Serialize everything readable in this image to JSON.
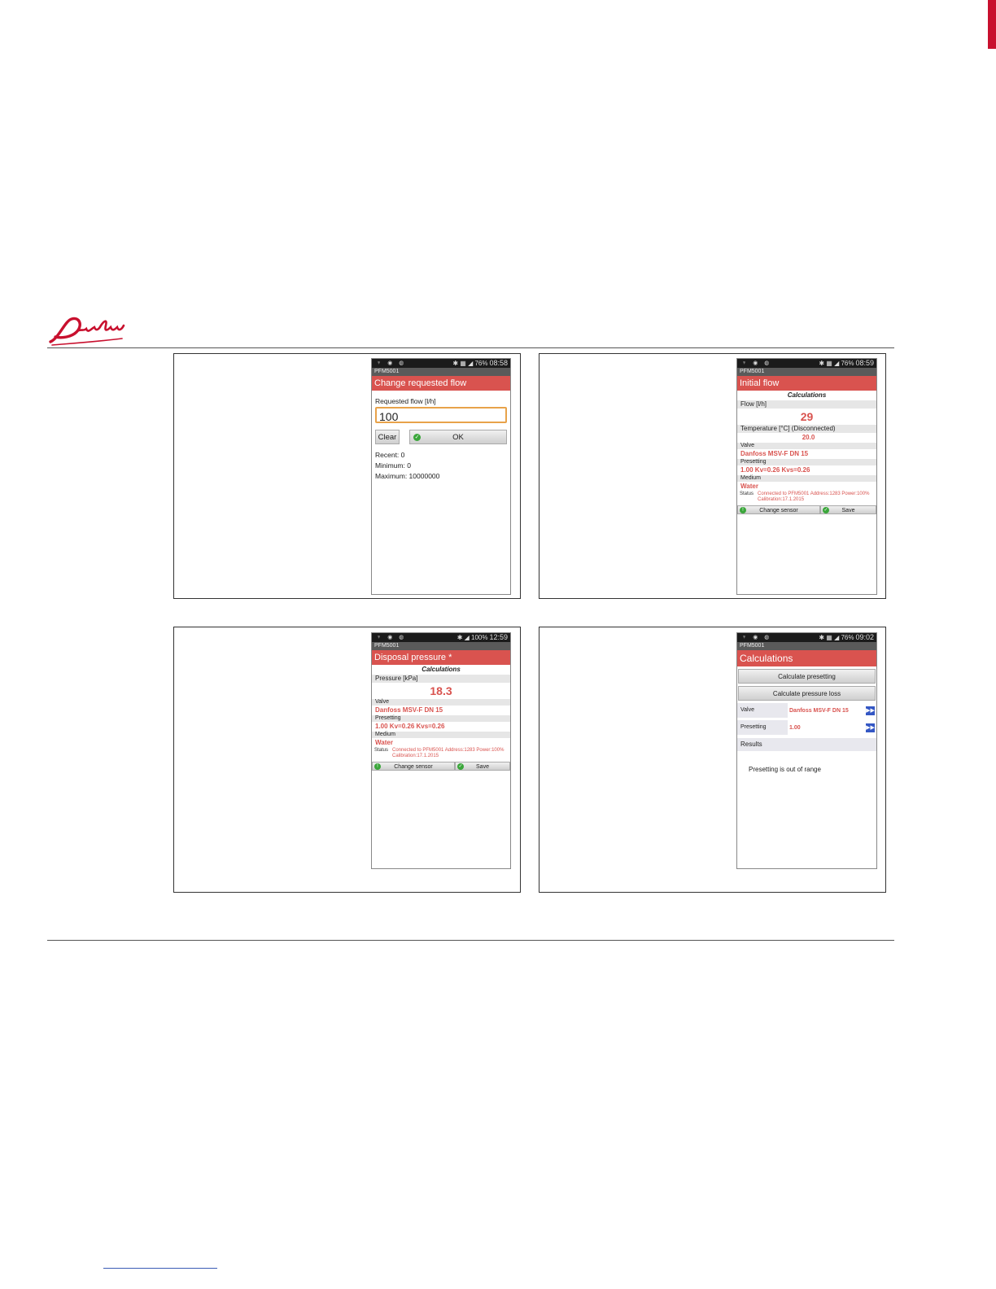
{
  "brand": {
    "name": "Danfoss",
    "color": "#c8102e"
  },
  "status_icons": "♆ ◉ ◍",
  "screens": [
    {
      "status": {
        "icons": "✱ ▦ ◢ 76%",
        "time": "08:58"
      },
      "app_name": "PFM5001",
      "title": "Change requested flow",
      "field_label": "Requested flow [l/h]",
      "field_value": "100",
      "clear_label": "Clear",
      "ok_label": "OK",
      "recent": "Recent: 0",
      "minimum": "Minimum: 0",
      "maximum": "Maximum: 10000000"
    },
    {
      "status": {
        "icons": "✱ ▦ ◢ 76%",
        "time": "08:59"
      },
      "app_name": "PFM5001",
      "title": "Initial flow",
      "calc_head": "Calculations",
      "main_label": "Flow [l/h]",
      "main_value": "29",
      "temp_label": "Temperature [°C] (Disconnected)",
      "temp_value": "20.0",
      "valve_label": "Valve",
      "valve_value": "Danfoss MSV-F  DN 15",
      "preset_label": "Presetting",
      "preset_value": "1.00 Kv=0.26 Kvs=0.26",
      "medium_label": "Medium",
      "medium_value": "Water",
      "status_label": "Status",
      "status_value": "Connected to PFM5001 Address:1283 Power:100% Calibration:17.1.2015",
      "change_label": "Change sensor",
      "save_label": "Save"
    },
    {
      "status": {
        "icons": "✱ ◢ 100%",
        "time": "12:59"
      },
      "app_name": "PFM5001",
      "title": "Disposal pressure *",
      "calc_head": "Calculations",
      "main_label": "Pressure [kPa]",
      "main_value": "18.3",
      "valve_label": "Valve",
      "valve_value": "Danfoss MSV-F  DN 15",
      "preset_label": "Presetting",
      "preset_value": "1.00 Kv=0.26 Kvs=0.26",
      "medium_label": "Medium",
      "medium_value": "Water",
      "status_label": "Status",
      "status_value": "Connected to PFM5001 Address:1283 Power:100% Calibration:17.1.2015",
      "change_label": "Change sensor",
      "save_label": "Save"
    },
    {
      "status": {
        "icons": "✱ ▦ ◢ 76%",
        "time": "09:02"
      },
      "app_name": "PFM5001",
      "title": "Calculations",
      "btn1": "Calculate presetting",
      "btn2": "Calculate pressure loss",
      "valve_label": "Valve",
      "valve_value": "Danfoss MSV-F  DN 15",
      "preset_label": "Presetting",
      "preset_value": "1.00",
      "results_label": "Results",
      "message": "Presetting is out of range"
    }
  ]
}
